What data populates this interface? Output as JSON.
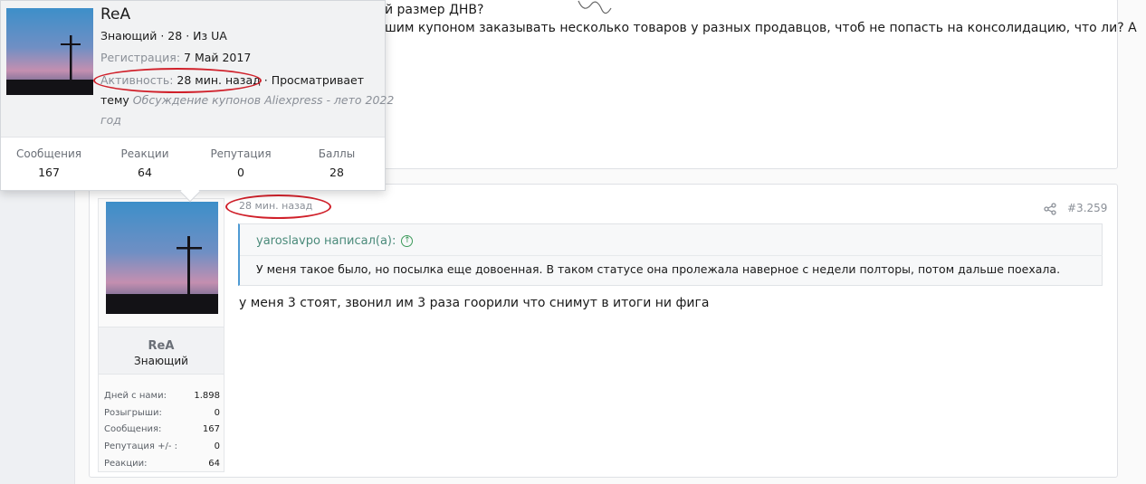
{
  "prev_post": {
    "line1": "й размер ДНВ?",
    "line2": "шим купоном заказывать несколько товаров у разных продавцов, чтоб не попасть на консолидацию, что ли? А"
  },
  "tooltip": {
    "name": "ReA",
    "info": "Знающий · 28 · Из UA",
    "reg_label": "Регистрация:",
    "reg_value": "7 Май 2017",
    "activity_label": "Активность:",
    "activity_value": "28 мин. назад",
    "activity_suffix": "· Просматривает",
    "topic_prefix": "тему",
    "topic_link": "Обсуждение купонов Aliexpress - лето 2022",
    "topic_link_cont": "год",
    "stats": [
      {
        "label": "Сообщения",
        "value": "167"
      },
      {
        "label": "Реакции",
        "value": "64"
      },
      {
        "label": "Репутация",
        "value": "0"
      },
      {
        "label": "Баллы",
        "value": "28"
      }
    ]
  },
  "post": {
    "time": "28 мин. назад",
    "number": "#3.259",
    "quote_author": "yaroslavpo написал(а):",
    "quote_text": "У меня такое было, но посылка еще довоенная. В таком статусе она пролежала наверное с недели полторы, потом дальше поехала.",
    "body": "у меня 3 стоят, звонил им 3 раза гоорили что снимут в итоги ни фига"
  },
  "user": {
    "name": "ReA",
    "title": "Знающий",
    "stats": [
      {
        "label": "Дней с нами:",
        "value": "1.898"
      },
      {
        "label": "Розыгрыши:",
        "value": "0"
      },
      {
        "label": "Сообщения:",
        "value": "167"
      },
      {
        "label": "Репутация +/- :",
        "value": "0"
      },
      {
        "label": "Реакции:",
        "value": "64"
      }
    ]
  },
  "icons": {
    "share": "share-icon",
    "quote_up": "arrow-up-circle-icon"
  },
  "colors": {
    "highlight_ellipse": "#d0202a",
    "quote_accent": "#4f9bd4"
  }
}
